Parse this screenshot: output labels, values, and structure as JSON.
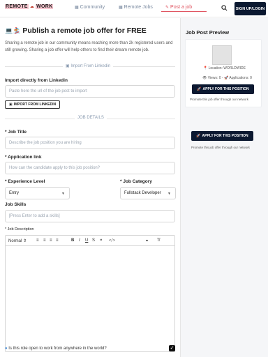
{
  "nav": {
    "logo_left": "REMOTE",
    "logo_mid": "☁",
    "logo_right": "WORK",
    "links": [
      {
        "label": "Community"
      },
      {
        "label": "Remote Jobs"
      },
      {
        "label": "Post a job"
      }
    ],
    "signup_label": "SIGN UP/LOGIN",
    "accent_color": "#e05561",
    "dark_color": "#0b1830"
  },
  "main": {
    "title": "Publish a remote job offer for FREE",
    "title_emoji": "💻🏂",
    "intro": "Sharing a remote job in our community means reaching more than 2k registered users and still growing. Sharing a job offer will help others to find their dream remote job.",
    "import_divider": "Import From Linkedin",
    "import_label": "Import directly from Linkedin",
    "import_placeholder": "Paste here the url of the job post to import",
    "import_button": "IMPORT FROM LINKEDIN",
    "details_divider": "JOB DETAILS",
    "job_title_label": "* Job Title",
    "job_title_placeholder": "Describe the job position you are hiring",
    "app_link_label": "* Application link",
    "app_link_placeholder": "How can the candidate apply to this job position?",
    "experience_label": "* Experience Level",
    "experience_value": "Entry",
    "category_label": "* Job Category",
    "category_value": "Fullstack Developer",
    "skills_label": "Job Skills",
    "skills_placeholder": "[Press Enter to add a skills]",
    "description_label": "* Job Description",
    "toolbar": {
      "style": "Normal",
      "quote": "❝",
      "code": "</>"
    },
    "remote_question": "Is this role open to work from anywhere in the world?",
    "remote_checked": true
  },
  "sidebar": {
    "title": "Job Post Preview",
    "location": "Location: WORLDWIDE",
    "views": "Views: 0",
    "applications": "Applications: 0",
    "apply_label": "APPLY FOR THIS POSITION",
    "promote_text": "Promote this job offer through our network"
  }
}
